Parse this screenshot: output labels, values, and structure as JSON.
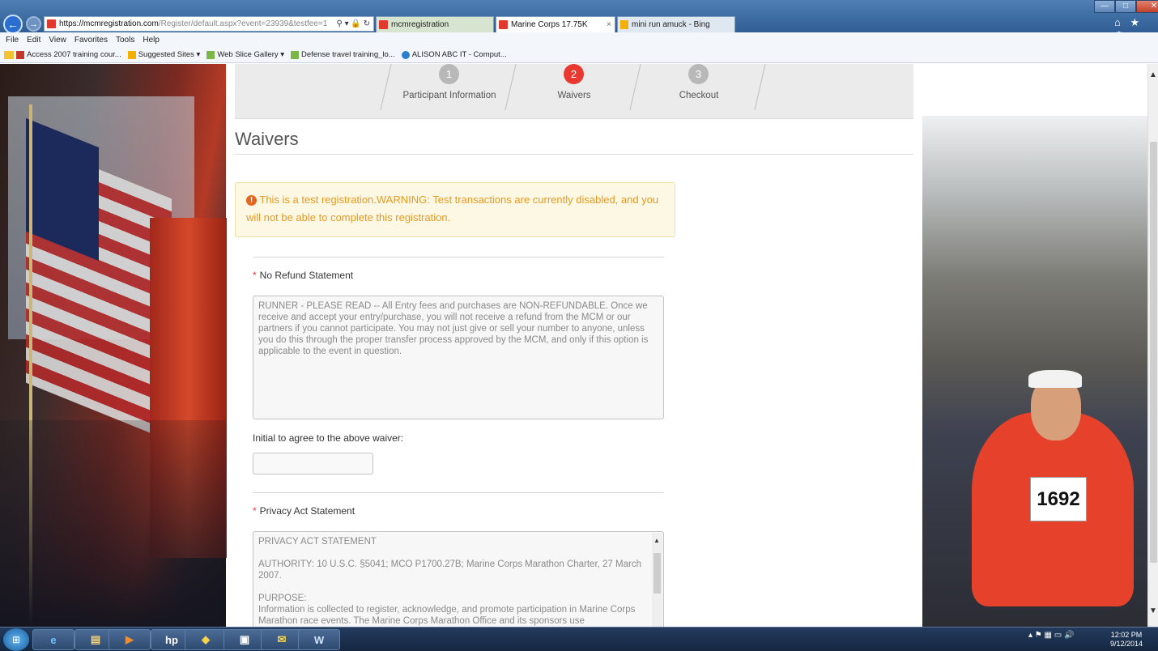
{
  "browser": {
    "url_domain": "https://mcmregistration.com",
    "url_path": "/Register/default.aspx?event=23939&testfee=1",
    "address_tools": "⚲ ▾ 🔒 ↻",
    "tabs": [
      {
        "label": "mcmregistration"
      },
      {
        "label": "Marine Corps 17.75K"
      },
      {
        "label": "mini run amuck - Bing"
      }
    ],
    "tab_close": "×",
    "window_controls": [
      "—",
      "□",
      "✕"
    ],
    "toolbar_icons": "⌂ ★ ⚙",
    "menu": [
      "File",
      "Edit",
      "View",
      "Favorites",
      "Tools",
      "Help"
    ],
    "favorites": [
      "Access 2007 training cour...",
      "Suggested Sites ▾",
      "Web Slice Gallery ▾",
      "Defense travel training_lo...",
      "ALISON ABC IT - Comput..."
    ]
  },
  "steps": [
    {
      "num": "1",
      "label": "Participant Information"
    },
    {
      "num": "2",
      "label": "Waivers"
    },
    {
      "num": "3",
      "label": "Checkout"
    }
  ],
  "page": {
    "title": "Waivers",
    "alert_icon": "!",
    "alert": "This is a test registration.WARNING: Test transactions are currently disabled, and you will not be able to complete this registration.",
    "required_mark": "*",
    "no_refund_label": "No Refund Statement",
    "no_refund_text": "RUNNER - PLEASE READ  --  All Entry fees and purchases are NON-REFUNDABLE. Once we receive and accept your entry/purchase, you will not receive a refund from the MCM or our partners if you cannot participate. You may not just give or sell your number to anyone, unless you do this through the proper transfer process approved by the MCM, and only if this option is applicable to the event in question.",
    "initial_label": "Initial to agree to the above waiver:",
    "initial_value": "",
    "privacy_label": "Privacy Act Statement",
    "privacy_lines": [
      "PRIVACY ACT STATEMENT",
      "AUTHORITY: 10 U.S.C. §5041; MCO P1700.27B; Marine Corps Marathon Charter, 27 March 2007.",
      "PURPOSE:",
      "Information is collected to register, acknowledge, and promote participation in Marine Corps Marathon race events.  The Marine Corps Marathon Office and its sponsors use"
    ]
  },
  "photo": {
    "bib_number": "1692"
  },
  "taskbar": {
    "start": "⊞",
    "apps": [
      "e",
      "▤",
      "▶",
      "hp",
      "◆",
      "▣",
      "✉",
      "W"
    ],
    "tray": "▴  ⚑  ▦  ▭  🔊",
    "time": "12:02 PM",
    "date": "9/12/2014"
  }
}
